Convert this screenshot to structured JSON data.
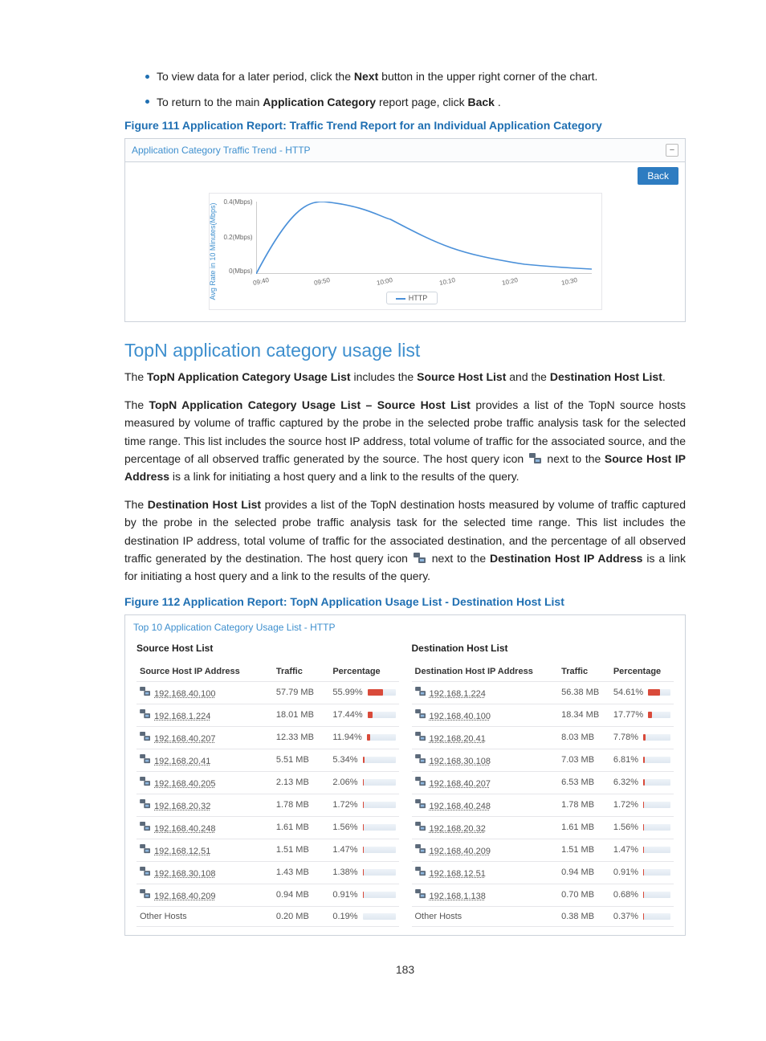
{
  "bullets": [
    {
      "pre": "To view data for a later period, click the ",
      "bold": "Next",
      "post": " button in the upper right corner of the chart."
    },
    {
      "pre": "To return to the main ",
      "bold": "Application Category",
      "post": " report page, click ",
      "bold2": "Back",
      "post2": "."
    }
  ],
  "fig111": {
    "caption": "Figure 111 Application Report: Traffic Trend Report for an Individual Application Category",
    "panel_title": "Application Category Traffic Trend - HTTP",
    "back_label": "Back",
    "ylabel": "Avg Rate in 10 Minutes(Mbps)",
    "legend": "HTTP",
    "y_ticks": [
      "0.4(Mbps)",
      "0.2(Mbps)",
      "0(Mbps)"
    ],
    "x_ticks": [
      "09:40",
      "09:50",
      "10:00",
      "10:10",
      "10:20",
      "10:30"
    ]
  },
  "section_heading": "TopN application category usage list",
  "para1": {
    "pre": "The ",
    "b": "TopN Application Category Usage List",
    "mid": " includes the ",
    "b2": "Source Host List",
    "mid2": " and the ",
    "b3": "Destination Host List",
    "post": "."
  },
  "para2": {
    "pre": "The ",
    "b": "TopN Application Category Usage List – Source Host List",
    "post": " provides a list of the TopN source hosts measured by volume of traffic captured by the probe in the selected probe traffic analysis task for the selected time range. This list includes the source host IP address, total volume of traffic for the associated source, and the percentage of all observed traffic generated by the source. The host query icon ",
    "post2": " next to the ",
    "b2": "Source Host IP Address",
    "post3": " is a link for initiating a host query and a link to the results of the query."
  },
  "para3": {
    "pre": "The ",
    "b": "Destination Host List",
    "post": " provides a list of the TopN destination hosts measured by volume of traffic captured by the probe in the selected probe traffic analysis task for the selected time range. This list includes the destination IP address, total volume of traffic for the associated destination, and the percentage of all observed traffic generated by the destination. The host query icon ",
    "post2": " next to the ",
    "b2": "Destination Host IP Address",
    "post3": " is a link for initiating a host query and a link to the results of the query."
  },
  "fig112": {
    "caption": "Figure 112 Application Report: TopN Application Usage List - Destination Host List",
    "panel_title": "Top 10 Application Category Usage List - HTTP",
    "source_title": "Source Host List",
    "dest_title": "Destination Host List",
    "headers": {
      "src_ip": "Source Host IP Address",
      "dst_ip": "Destination Host IP Address",
      "traffic": "Traffic",
      "pct": "Percentage"
    },
    "other_label": "Other Hosts",
    "source_rows": [
      {
        "ip": "192.168.40.100",
        "traffic": "57.79 MB",
        "pct": "55.99%",
        "w": 55.99
      },
      {
        "ip": "192.168.1.224",
        "traffic": "18.01 MB",
        "pct": "17.44%",
        "w": 17.44
      },
      {
        "ip": "192.168.40.207",
        "traffic": "12.33 MB",
        "pct": "11.94%",
        "w": 11.94
      },
      {
        "ip": "192.168.20.41",
        "traffic": "5.51 MB",
        "pct": "5.34%",
        "w": 5.34
      },
      {
        "ip": "192.168.40.205",
        "traffic": "2.13 MB",
        "pct": "2.06%",
        "w": 2.06
      },
      {
        "ip": "192.168.20.32",
        "traffic": "1.78 MB",
        "pct": "1.72%",
        "w": 1.72
      },
      {
        "ip": "192.168.40.248",
        "traffic": "1.61 MB",
        "pct": "1.56%",
        "w": 1.56
      },
      {
        "ip": "192.168.12.51",
        "traffic": "1.51 MB",
        "pct": "1.47%",
        "w": 1.47
      },
      {
        "ip": "192.168.30.108",
        "traffic": "1.43 MB",
        "pct": "1.38%",
        "w": 1.38
      },
      {
        "ip": "192.168.40.209",
        "traffic": "0.94 MB",
        "pct": "0.91%",
        "w": 0.91
      }
    ],
    "source_other": {
      "traffic": "0.20 MB",
      "pct": "0.19%",
      "w": 0.19
    },
    "dest_rows": [
      {
        "ip": "192.168.1.224",
        "traffic": "56.38 MB",
        "pct": "54.61%",
        "w": 54.61
      },
      {
        "ip": "192.168.40.100",
        "traffic": "18.34 MB",
        "pct": "17.77%",
        "w": 17.77
      },
      {
        "ip": "192.168.20.41",
        "traffic": "8.03 MB",
        "pct": "7.78%",
        "w": 7.78
      },
      {
        "ip": "192.168.30.108",
        "traffic": "7.03 MB",
        "pct": "6.81%",
        "w": 6.81
      },
      {
        "ip": "192.168.40.207",
        "traffic": "6.53 MB",
        "pct": "6.32%",
        "w": 6.32
      },
      {
        "ip": "192.168.40.248",
        "traffic": "1.78 MB",
        "pct": "1.72%",
        "w": 1.72
      },
      {
        "ip": "192.168.20.32",
        "traffic": "1.61 MB",
        "pct": "1.56%",
        "w": 1.56
      },
      {
        "ip": "192.168.40.209",
        "traffic": "1.51 MB",
        "pct": "1.47%",
        "w": 1.47
      },
      {
        "ip": "192.168.12.51",
        "traffic": "0.94 MB",
        "pct": "0.91%",
        "w": 0.91
      },
      {
        "ip": "192.168.1.138",
        "traffic": "0.70 MB",
        "pct": "0.68%",
        "w": 0.68
      }
    ],
    "dest_other": {
      "traffic": "0.38 MB",
      "pct": "0.37%",
      "w": 0.37
    }
  },
  "page_number": "183",
  "chart_data": {
    "type": "line",
    "title": "Application Category Traffic Trend - HTTP",
    "ylabel": "Avg Rate in 10 Minutes(Mbps)",
    "x": [
      "09:40",
      "09:50",
      "10:00",
      "10:10",
      "10:20",
      "10:30"
    ],
    "series": [
      {
        "name": "HTTP",
        "values": [
          0.0,
          0.4,
          0.3,
          0.1,
          0.06,
          0.04
        ]
      }
    ],
    "ylim": [
      0,
      0.4
    ]
  }
}
